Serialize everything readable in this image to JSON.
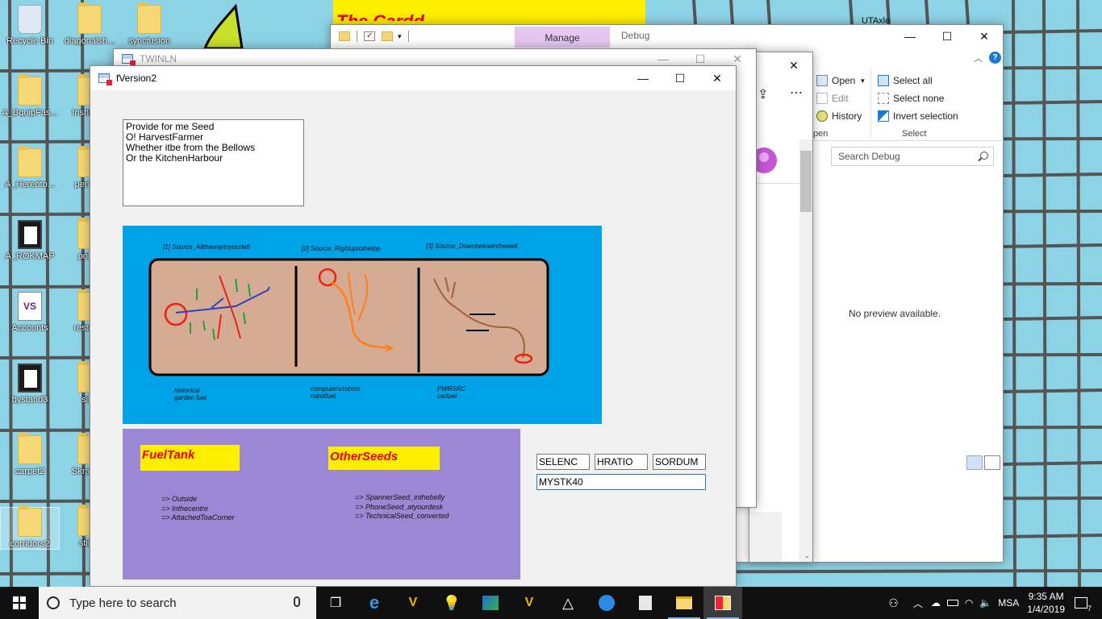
{
  "desktop": {
    "icons": [
      {
        "label": "Recycle Bin",
        "type": "recycle"
      },
      {
        "label": "diagonalsh...",
        "type": "folder"
      },
      {
        "label": "syncfusion",
        "type": "folder"
      },
      {
        "label": "A_BquipFas...",
        "type": "folder"
      },
      {
        "label": "IrishBa...",
        "type": "folder"
      },
      {
        "label": "A_Hererito...",
        "type": "folder"
      },
      {
        "label": "penta...",
        "type": "folder"
      },
      {
        "label": "A_ROKMAP",
        "type": "dark-doc"
      },
      {
        "label": "poly...",
        "type": "folder"
      },
      {
        "label": "Accounts",
        "type": "vs-doc"
      },
      {
        "label": "restco...",
        "type": "folder"
      },
      {
        "label": "bystand3",
        "type": "dark-doc"
      },
      {
        "label": "sil...",
        "type": "folder"
      },
      {
        "label": "carpet2",
        "type": "folder"
      },
      {
        "label": "Skrape...",
        "type": "folder"
      },
      {
        "label": "corridors2",
        "type": "folder"
      },
      {
        "label": "stig...",
        "type": "folder"
      }
    ],
    "top_right_label": "UTAxle"
  },
  "yellow_app": {
    "title_fragment": "The Cardd..."
  },
  "explorer": {
    "tab_manage": "Manage",
    "tab_debug": "Debug",
    "ribbon": {
      "open": "Open",
      "edit": "Edit",
      "history": "History",
      "open_group": "pen",
      "select_all": "Select all",
      "select_none": "Select none",
      "invert_selection": "Invert selection",
      "select_group": "Select"
    },
    "search_placeholder": "Search Debug",
    "preview_message": "No preview available.",
    "accent": "#e6c7f1"
  },
  "twinln": {
    "title": "TWINLN"
  },
  "fversion": {
    "title": "fVersion2",
    "poem_lines": [
      "Provide for me Seed",
      "O! HarvestFarmer",
      "Whether itbe from the Bellows",
      "Or the KitchenHarbour"
    ],
    "diagram": {
      "sources": [
        "[1] Source_Allthewaytoyourleft",
        "[2] Source_Rightuptothetop",
        "[3] Source_Downbelowinthewell"
      ],
      "captions": [
        [
          "historical",
          "garden fuel"
        ],
        [
          "computers/robots",
          "robotfuel"
        ],
        [
          "PWRSRC",
          "carfuel"
        ]
      ],
      "panel_color": "#00a2e8",
      "board_color": "#d5ab94"
    },
    "fueltank": {
      "heading": "FuelTank",
      "items": [
        "=> Outside",
        "=> Inthecentre",
        "=> AttachedToaCorner"
      ]
    },
    "otherseeds": {
      "heading": "OtherSeeds",
      "items": [
        "=> SpannerSeed_inthebelly",
        "=> PhoneSeed_atyourdesk",
        "=> TechnicalSeed_converted"
      ]
    },
    "inputs": {
      "box1": "SELENC",
      "box2": "HRATIO",
      "box3": "SORDUM",
      "box4": "MYSTK40"
    },
    "purple": "#9b87d3"
  },
  "taskbar": {
    "search_placeholder": "Type here to search",
    "language": "MSA",
    "time": "9:35 AM",
    "date": "1/4/2019",
    "notifications": "7"
  }
}
